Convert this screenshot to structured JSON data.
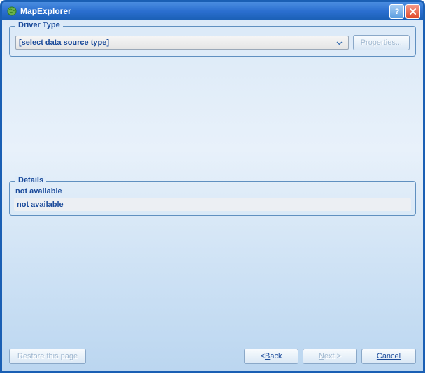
{
  "window": {
    "title": "MapExplorer"
  },
  "driver": {
    "legend": "Driver Type",
    "selected": "[select data source type]",
    "properties_label": "Properties..."
  },
  "details": {
    "legend": "Details",
    "line1": "not available",
    "line2": "not available"
  },
  "footer": {
    "restore": "Restore this page",
    "back_prefix": "< ",
    "back_letter": "B",
    "back_rest": "ack",
    "next_letter": "N",
    "next_rest": "ext >",
    "cancel": "Cancel"
  }
}
